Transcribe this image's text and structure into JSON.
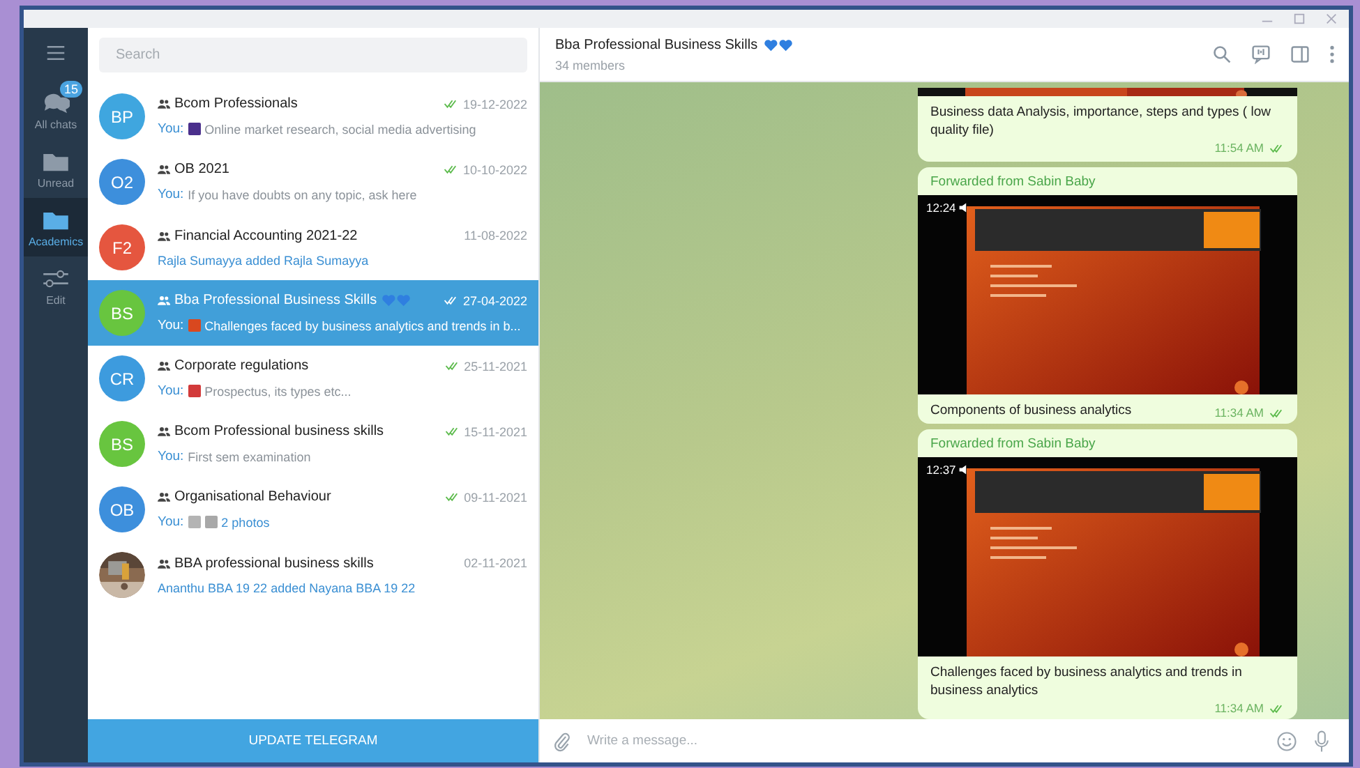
{
  "sidebar": {
    "items": [
      {
        "kind": "menu",
        "selected": false
      },
      {
        "kind": "chats",
        "label": "All chats",
        "badge": "15",
        "selected": false
      },
      {
        "kind": "folder",
        "label": "Unread",
        "selected": false
      },
      {
        "kind": "folder",
        "label": "Academics",
        "selected": true
      },
      {
        "kind": "edit",
        "label": "Edit",
        "selected": false
      }
    ]
  },
  "chat_list": {
    "search": {
      "placeholder": "Search"
    },
    "chats": [
      {
        "initials": "BP",
        "color": "#3fa6df",
        "title": "Bcom Professionals",
        "date": "19-12-2022",
        "read": true,
        "sender": "You:",
        "thumbs": [
          {
            "color": "#4a2f8c"
          }
        ],
        "preview": "Online market research, social media advertising",
        "service": false,
        "selected": false
      },
      {
        "initials": "O2",
        "color": "#3d8fdc",
        "title": "OB 2021",
        "date": "10-10-2022",
        "read": true,
        "sender": "You:",
        "preview": "If you have doubts on any topic, ask here",
        "service": false,
        "selected": false
      },
      {
        "initials": "F2",
        "color": "#e5563f",
        "title": "Financial Accounting 2021-22",
        "date": "11-08-2022",
        "read": false,
        "preview": "Rajla Sumayya added Rajla Sumayya",
        "service": true,
        "selected": false
      },
      {
        "initials": "BS",
        "color": "#68c53f",
        "title": "Bba Professional Business Skills",
        "title_hearts": true,
        "date": "27-04-2022",
        "read": true,
        "sender": "You:",
        "thumbs": [
          {
            "color": "#d9481f"
          }
        ],
        "preview": "Challenges faced by business analytics and trends in b...",
        "service": false,
        "selected": true
      },
      {
        "initials": "CR",
        "color": "#3d9bde",
        "title": "Corporate regulations",
        "date": "25-11-2021",
        "read": true,
        "sender": "You:",
        "thumbs": [
          {
            "color": "#d23a3a"
          }
        ],
        "preview": "Prospectus, its types etc...",
        "service": false,
        "selected": false
      },
      {
        "initials": "BS",
        "color": "#68c53f",
        "title": "Bcom Professional business skills",
        "date": "15-11-2021",
        "read": true,
        "sender": "You:",
        "preview": "First sem examination",
        "service": false,
        "selected": false
      },
      {
        "initials": "OB",
        "color": "#3d8fdc",
        "title": "Organisational Behaviour",
        "date": "09-11-2021",
        "read": true,
        "sender": "You:",
        "thumbs": [
          {
            "color": "#b4b4b4"
          },
          {
            "color": "#a8a8a8"
          }
        ],
        "preview": "2 photos",
        "service": true,
        "selected": false
      },
      {
        "title": "BBA professional business skills",
        "date": "02-11-2021",
        "read": false,
        "preview": "Ananthu BBA 19 22 added Nayana BBA 19 22",
        "service": true,
        "selected": false
      }
    ],
    "update_button": "UPDATE TELEGRAM"
  },
  "chat": {
    "title": "Bba Professional Business Skills",
    "title_hearts": true,
    "subtitle": "34 members",
    "messages": [
      {
        "kind": "text",
        "top_picture": true,
        "text": "Business data Analysis, importance, steps and types ( low quality file)",
        "time": "11:54 AM",
        "read": true
      },
      {
        "kind": "video",
        "forwarded_from": "Forwarded from Sabin Baby",
        "duration": "12:24",
        "caption": "Components of business analytics",
        "time": "11:34 AM",
        "read": true
      },
      {
        "kind": "video",
        "forwarded_from": "Forwarded from Sabin Baby",
        "duration": "12:37",
        "caption": "Challenges faced by business analytics and trends in business analytics",
        "time": "11:34 AM",
        "read": true
      }
    ],
    "input": {
      "placeholder": "Write a message..."
    }
  }
}
